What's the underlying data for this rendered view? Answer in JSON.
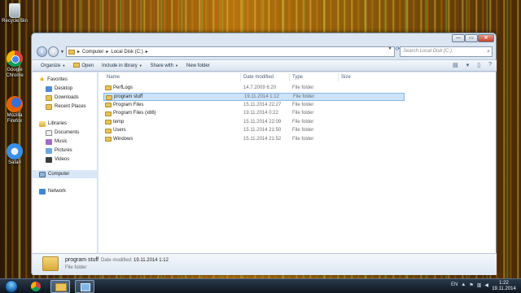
{
  "desktop": {
    "icons": [
      {
        "label": "Recycle Bin"
      },
      {
        "label": "Google Chrome"
      },
      {
        "label": "Mozilla Firefox"
      },
      {
        "label": "Safari"
      }
    ]
  },
  "window": {
    "controls": {
      "minimize": "—",
      "maximize": "▭",
      "close": "✕"
    },
    "address": {
      "segments": [
        "Computer",
        "Local Disk (C:)"
      ],
      "separator": "▸"
    },
    "search": {
      "placeholder": "Search Local Disk (C:)"
    },
    "toolbar": {
      "organize": "Organize",
      "open": "Open",
      "include": "Include in library",
      "share": "Share with",
      "new_folder": "New folder"
    },
    "navpane": {
      "favorites": {
        "label": "Favorites",
        "items": [
          "Desktop",
          "Downloads",
          "Recent Places"
        ]
      },
      "libraries": {
        "label": "Libraries",
        "items": [
          "Documents",
          "Music",
          "Pictures",
          "Videos"
        ]
      },
      "computer": "Computer",
      "network": "Network"
    },
    "columns": {
      "name": "Name",
      "date": "Date modified",
      "type": "Type",
      "size": "Size"
    },
    "files": [
      {
        "name": "PerfLogs",
        "date": "14.7.2009 6:20",
        "type": "File folder"
      },
      {
        "name": "program stuff",
        "date": "19.11.2014 1:12",
        "type": "File folder"
      },
      {
        "name": "Program Files",
        "date": "15.11.2014 22:27",
        "type": "File folder"
      },
      {
        "name": "Program Files (x86)",
        "date": "19.11.2014 0:22",
        "type": "File folder"
      },
      {
        "name": "temp",
        "date": "15.11.2014 22:09",
        "type": "File folder"
      },
      {
        "name": "Users",
        "date": "15.11.2014 21:50",
        "type": "File folder"
      },
      {
        "name": "Windows",
        "date": "15.11.2014 21:52",
        "type": "File folder"
      }
    ],
    "selected_index": 1,
    "details": {
      "name": "program stuff",
      "date_label": "Date modified:",
      "date": "19.11.2014 1:12",
      "type": "File folder"
    }
  },
  "taskbar": {
    "clock": {
      "time": "1:22",
      "date": "19.11.2014"
    },
    "tray_label": "EN"
  }
}
